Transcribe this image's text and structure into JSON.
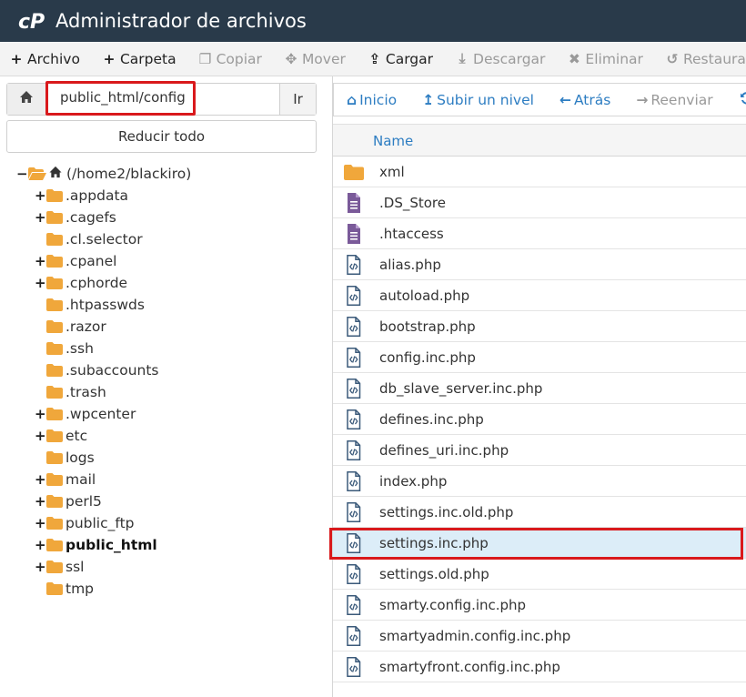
{
  "app": {
    "title": "Administrador de archivos",
    "logo_text": "cP",
    "accent_color": "#2d7dc2",
    "titlebar_color": "#293a4a",
    "highlight_color": "#d9191c",
    "folder_color": "#f0a73b",
    "file_text_color": "#7a5a99"
  },
  "toolbar": {
    "items": [
      {
        "label": "Archivo",
        "icon": "plus-icon",
        "glyph": "+",
        "disabled": false
      },
      {
        "label": "Carpeta",
        "icon": "plus-icon",
        "glyph": "+",
        "disabled": false
      },
      {
        "label": "Copiar",
        "icon": "copy-icon",
        "glyph": "❐",
        "disabled": true
      },
      {
        "label": "Mover",
        "icon": "move-icon",
        "glyph": "✥",
        "disabled": true
      },
      {
        "label": "Cargar",
        "icon": "upload-icon",
        "glyph": "⇪",
        "disabled": false
      },
      {
        "label": "Descargar",
        "icon": "download-icon",
        "glyph": "⤓",
        "disabled": true
      },
      {
        "label": "Eliminar",
        "icon": "delete-icon",
        "glyph": "✖",
        "disabled": true
      },
      {
        "label": "Restaurar",
        "icon": "restore-icon",
        "glyph": "↺",
        "disabled": true
      }
    ]
  },
  "path_bar": {
    "value": "public_html/config",
    "go_label": "Ir",
    "home_icon": "home-icon"
  },
  "collapse_all_label": "Reducir todo",
  "tree": {
    "root": {
      "label": "(/home2/blackiro)",
      "toggle": "−",
      "icon": "home-icon"
    },
    "items": [
      {
        "label": ".appdata",
        "toggle": "+",
        "bold": false
      },
      {
        "label": ".cagefs",
        "toggle": "+",
        "bold": false
      },
      {
        "label": ".cl.selector",
        "toggle": "",
        "bold": false
      },
      {
        "label": ".cpanel",
        "toggle": "+",
        "bold": false
      },
      {
        "label": ".cphorde",
        "toggle": "+",
        "bold": false
      },
      {
        "label": ".htpasswds",
        "toggle": "",
        "bold": false
      },
      {
        "label": ".razor",
        "toggle": "",
        "bold": false
      },
      {
        "label": ".ssh",
        "toggle": "",
        "bold": false
      },
      {
        "label": ".subaccounts",
        "toggle": "",
        "bold": false
      },
      {
        "label": ".trash",
        "toggle": "",
        "bold": false
      },
      {
        "label": ".wpcenter",
        "toggle": "+",
        "bold": false
      },
      {
        "label": "etc",
        "toggle": "+",
        "bold": false
      },
      {
        "label": "logs",
        "toggle": "",
        "bold": false
      },
      {
        "label": "mail",
        "toggle": "+",
        "bold": false
      },
      {
        "label": "perl5",
        "toggle": "+",
        "bold": false
      },
      {
        "label": "public_ftp",
        "toggle": "+",
        "bold": false
      },
      {
        "label": "public_html",
        "toggle": "+",
        "bold": true
      },
      {
        "label": "ssl",
        "toggle": "+",
        "bold": false
      },
      {
        "label": "tmp",
        "toggle": "",
        "bold": false
      }
    ]
  },
  "nav": {
    "items": [
      {
        "label": "Inicio",
        "icon": "home-icon",
        "glyph": "⌂",
        "disabled": false
      },
      {
        "label": "Subir un nivel",
        "icon": "level-up-icon",
        "glyph": "↥",
        "disabled": false
      },
      {
        "label": "Atrás",
        "icon": "arrow-left-icon",
        "glyph": "←",
        "disabled": false
      },
      {
        "label": "Reenviar",
        "icon": "arrow-right-icon",
        "glyph": "→",
        "disabled": true
      }
    ],
    "reload_icon": "reload-icon"
  },
  "table": {
    "name_header": "Name",
    "files": [
      {
        "name": "xml",
        "type": "folder",
        "selected": false
      },
      {
        "name": ".DS_Store",
        "type": "text",
        "selected": false
      },
      {
        "name": ".htaccess",
        "type": "text",
        "selected": false
      },
      {
        "name": "alias.php",
        "type": "code",
        "selected": false
      },
      {
        "name": "autoload.php",
        "type": "code",
        "selected": false
      },
      {
        "name": "bootstrap.php",
        "type": "code",
        "selected": false
      },
      {
        "name": "config.inc.php",
        "type": "code",
        "selected": false
      },
      {
        "name": "db_slave_server.inc.php",
        "type": "code",
        "selected": false
      },
      {
        "name": "defines.inc.php",
        "type": "code",
        "selected": false
      },
      {
        "name": "defines_uri.inc.php",
        "type": "code",
        "selected": false
      },
      {
        "name": "index.php",
        "type": "code",
        "selected": false
      },
      {
        "name": "settings.inc.old.php",
        "type": "code",
        "selected": false
      },
      {
        "name": "settings.inc.php",
        "type": "code",
        "selected": true
      },
      {
        "name": "settings.old.php",
        "type": "code",
        "selected": false
      },
      {
        "name": "smarty.config.inc.php",
        "type": "code",
        "selected": false
      },
      {
        "name": "smartyadmin.config.inc.php",
        "type": "code",
        "selected": false
      },
      {
        "name": "smartyfront.config.inc.php",
        "type": "code",
        "selected": false
      }
    ]
  }
}
